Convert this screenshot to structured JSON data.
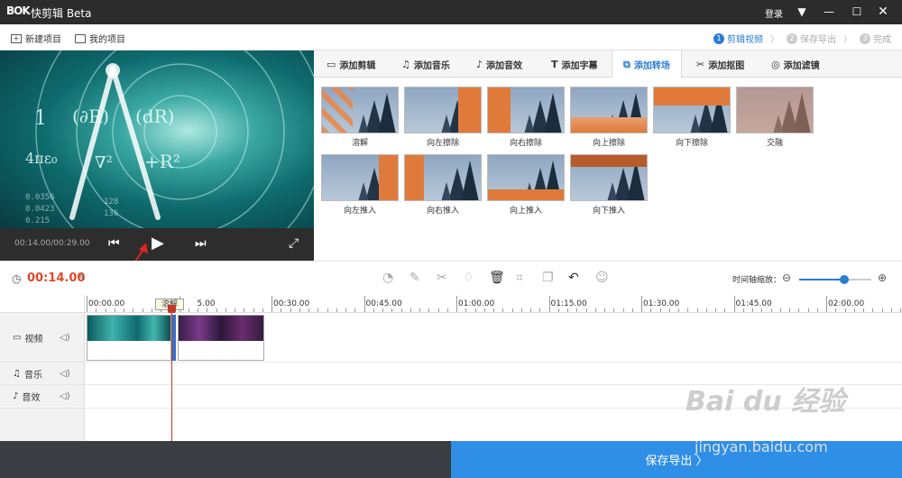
{
  "titlebar": {
    "logo": "BOK",
    "title": "快剪辑 Beta",
    "login": "登录",
    "menu_icon": "dropdown-icon",
    "min_icon": "minimize-icon",
    "max_icon": "maximize-icon",
    "close_icon": "close-icon"
  },
  "menubar": {
    "new_project": "新建项目",
    "my_projects": "我的项目",
    "steps": [
      {
        "num": "1",
        "label": "剪辑视频"
      },
      {
        "num": "2",
        "label": "保存导出"
      },
      {
        "num": "3",
        "label": "完成"
      }
    ]
  },
  "player": {
    "time": "00:14.00/00:29.00"
  },
  "tabs": [
    {
      "label": "添加剪辑",
      "icon": "video-icon"
    },
    {
      "label": "添加音乐",
      "icon": "music-icon"
    },
    {
      "label": "添加音效",
      "icon": "sound-effect-icon"
    },
    {
      "label": "添加字幕",
      "icon": "text-icon"
    },
    {
      "label": "添加转场",
      "icon": "transition-icon"
    },
    {
      "label": "添加抠图",
      "icon": "cutout-icon"
    },
    {
      "label": "添加滤镜",
      "icon": "filter-icon"
    }
  ],
  "transitions": [
    {
      "label": "溶解"
    },
    {
      "label": "向左擦除"
    },
    {
      "label": "向右擦除"
    },
    {
      "label": "向上擦除"
    },
    {
      "label": "向下擦除"
    },
    {
      "label": "交融"
    },
    {
      "label": "向左推入"
    },
    {
      "label": "向右推入"
    },
    {
      "label": "向上推入"
    },
    {
      "label": "向下推入"
    }
  ],
  "toolbar": {
    "current_time": "00:14.00",
    "zoom_label": "时间轴缩放：",
    "zoom_minus": "⊖",
    "zoom_plus": "⊕",
    "zoom_level": 0.62
  },
  "ruler": {
    "labels": [
      "00:00.00",
      "5.00",
      "00:30.00",
      "00:45.00",
      "01:00.00",
      "01:15.00",
      "01:30.00",
      "01:45.00",
      "02:00.00"
    ]
  },
  "tracks": {
    "video": "视频",
    "music": "音乐",
    "sfx": "音效"
  },
  "tooltip": "溶解",
  "save_button": "保存导出 〉",
  "watermark": {
    "brand": "Bai du 经验",
    "url": "jingyan.baidu.com"
  },
  "colors": {
    "accent": "#2b7cd3",
    "time_red": "#e0492c",
    "save_blue": "#2f8fe6"
  }
}
